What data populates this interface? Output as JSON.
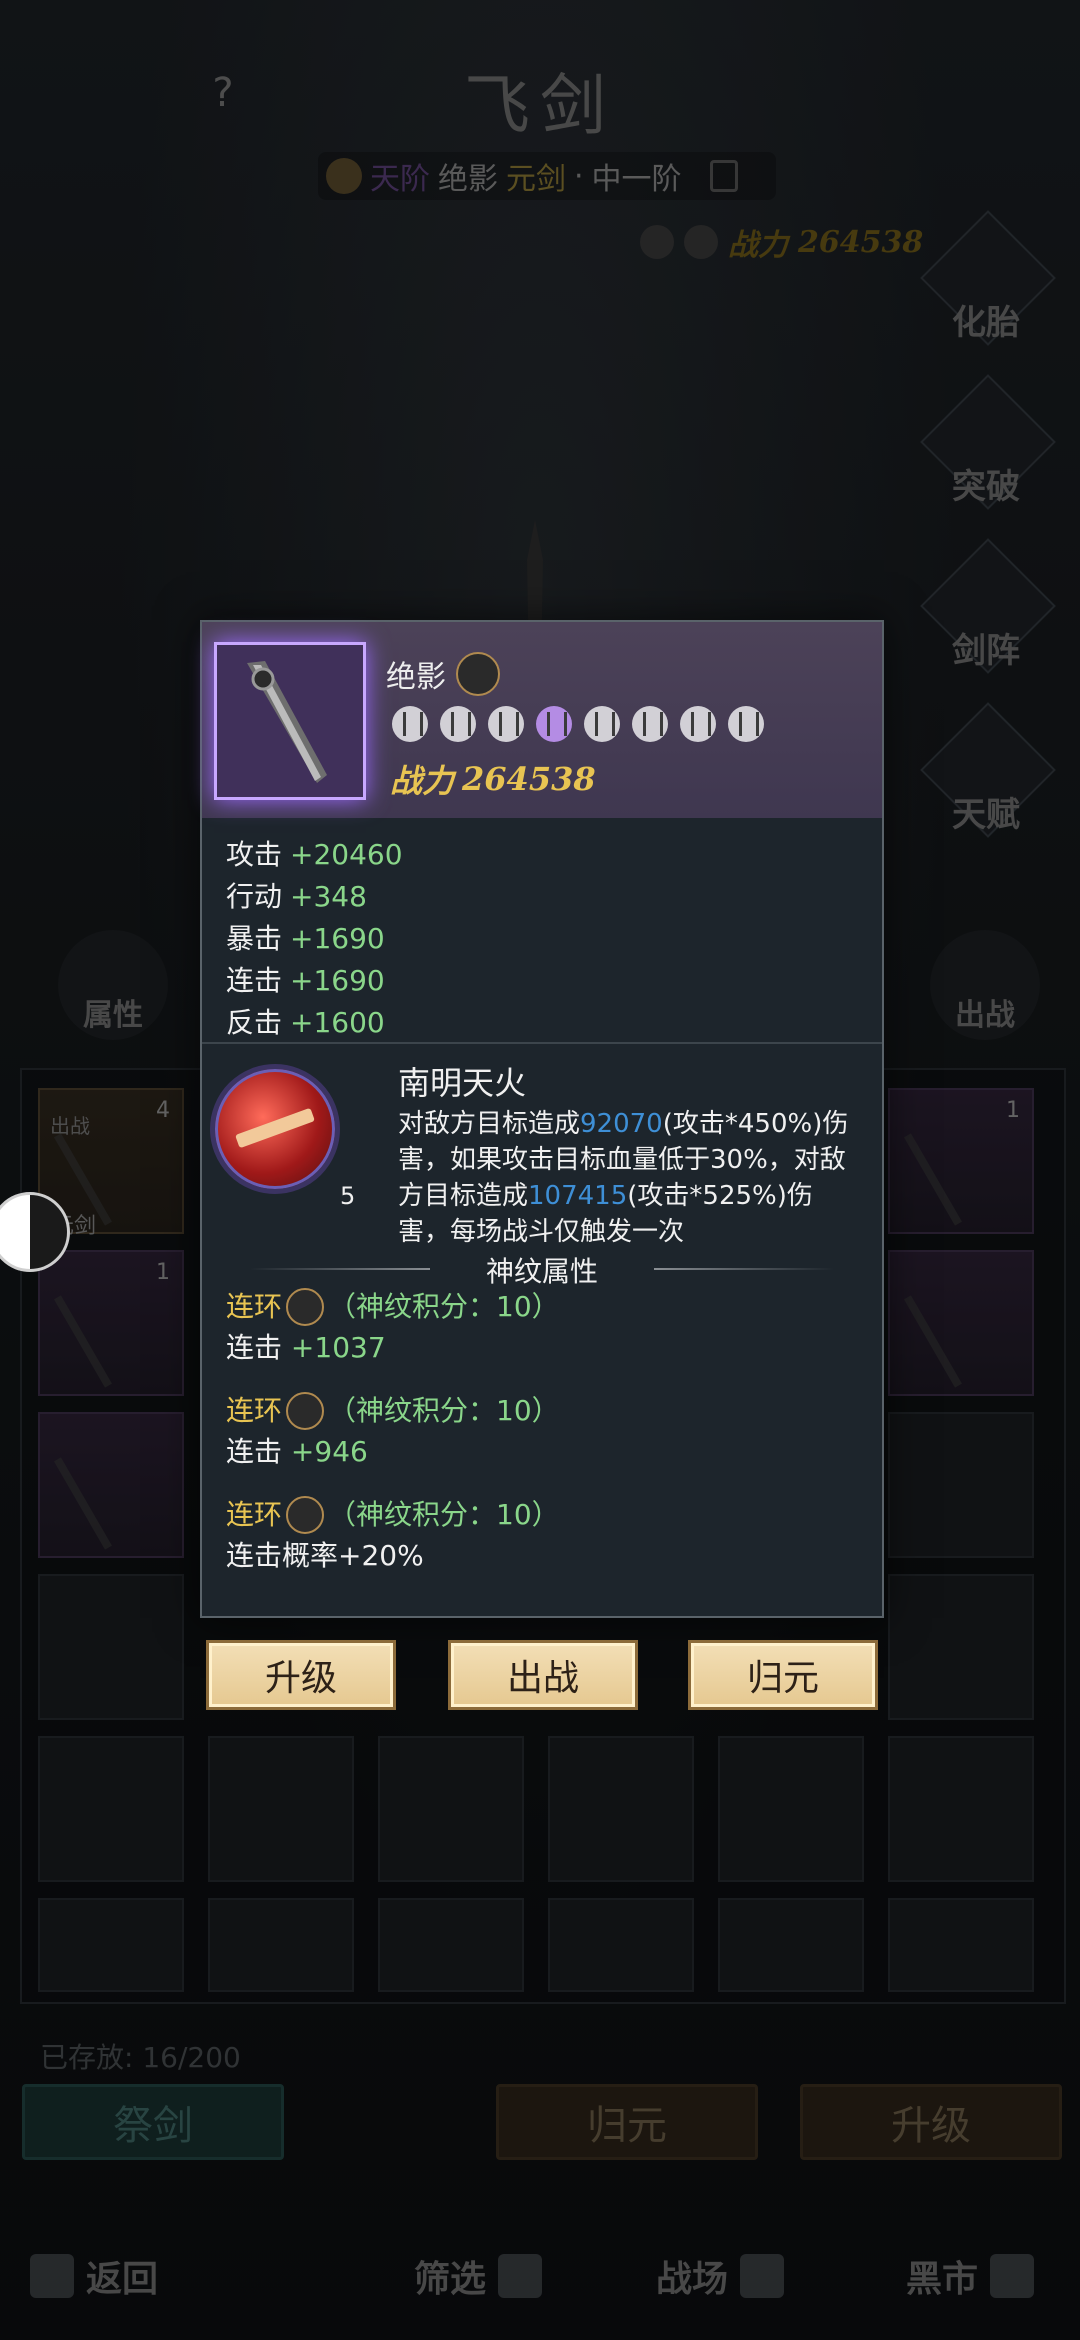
{
  "header": {
    "help": "?",
    "title": "飞剑",
    "subtitle": {
      "grade": "天阶",
      "name": "绝影",
      "type": "元剑",
      "dot": "·",
      "level": "中一阶"
    },
    "power_label": "战力",
    "power_value": "264538"
  },
  "side_menu": [
    {
      "label": "化胎"
    },
    {
      "label": "突破"
    },
    {
      "label": "剑阵"
    },
    {
      "label": "天赋"
    }
  ],
  "medals": {
    "left": "属性",
    "right": "出战"
  },
  "inventory": {
    "first_slot_tag": "出战",
    "first_slot_label": "元剑",
    "counts": [
      "4",
      "1",
      "1"
    ],
    "stored": "已存放: 16/200"
  },
  "bottom_actions": {
    "sacrifice": "祭剑",
    "return": "归元",
    "upgrade": "升级"
  },
  "nav": {
    "back": "返回",
    "filter": "筛选",
    "battle": "战场",
    "market": "黑市"
  },
  "popup": {
    "name": "绝影",
    "power_label": "战力",
    "power_value": "264538",
    "stats": [
      {
        "name": "攻击",
        "value": "+20460"
      },
      {
        "name": "行动",
        "value": "+348"
      },
      {
        "name": "暴击",
        "value": "+1690"
      },
      {
        "name": "连击",
        "value": "+1690"
      },
      {
        "name": "反击",
        "value": "+1600"
      }
    ],
    "skill": {
      "name": "南明天火",
      "level": "5",
      "desc_1": "对敌方目标造成",
      "desc_num1": "92070",
      "desc_2": "(攻击*450%)伤害，如果攻击目标血量低于30%，对敌方目标造成",
      "desc_num2": "107415",
      "desc_3": "(攻击*525%)伤害，每场战斗仅触发一次"
    },
    "rune_title": "神纹属性",
    "runes": [
      {
        "name": "连环",
        "score": "（神纹积分：10）",
        "stat": "连击",
        "value": "+1037"
      },
      {
        "name": "连环",
        "score": "（神纹积分：10）",
        "stat": "连击",
        "value": "+946"
      },
      {
        "name": "连环",
        "score": "（神纹积分：10）",
        "stat": "连击概率",
        "value": "+20%"
      }
    ],
    "buttons": {
      "upgrade": "升级",
      "deploy": "出战",
      "return": "归元"
    }
  }
}
